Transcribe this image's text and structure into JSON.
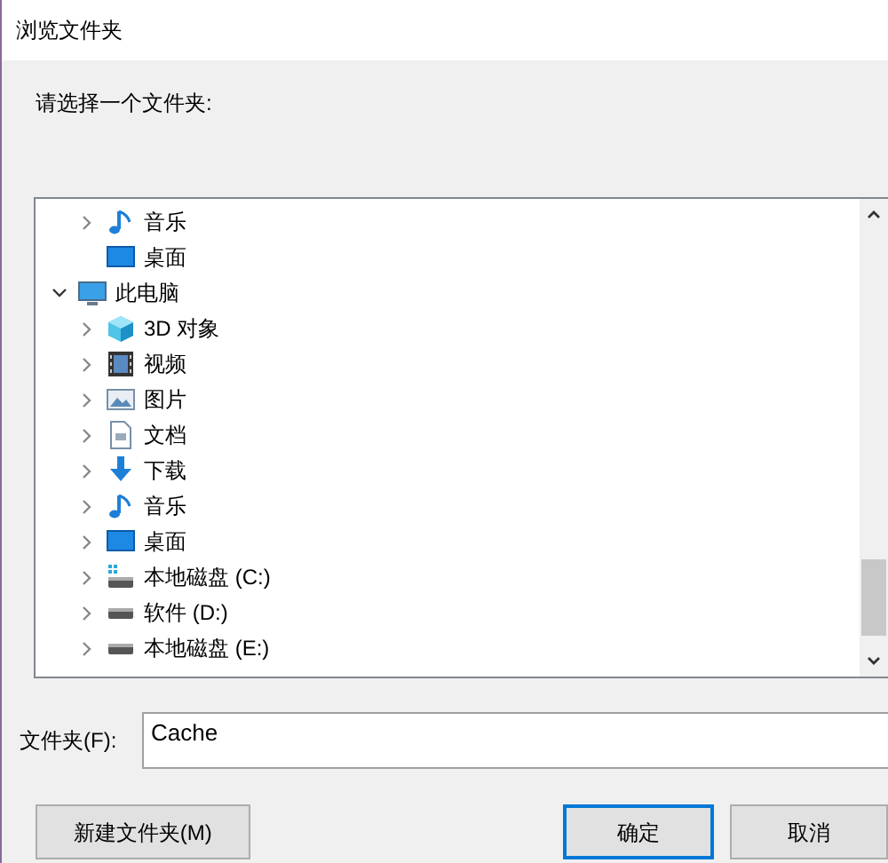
{
  "window": {
    "title": "浏览文件夹"
  },
  "prompt": "请选择一个文件夹:",
  "tree": {
    "continued_children": [
      {
        "label": "音乐",
        "kind": "music",
        "expandable": true,
        "expanded": false
      },
      {
        "label": "桌面",
        "kind": "desktop",
        "expandable": false
      }
    ],
    "items": [
      {
        "label": "此电脑",
        "kind": "computer",
        "expandable": true,
        "expanded": true,
        "children": [
          {
            "label": "3D 对象",
            "kind": "cube",
            "expandable": true,
            "expanded": false
          },
          {
            "label": "视频",
            "kind": "video",
            "expandable": true,
            "expanded": false
          },
          {
            "label": "图片",
            "kind": "pictures",
            "expandable": true,
            "expanded": false
          },
          {
            "label": "文档",
            "kind": "document",
            "expandable": true,
            "expanded": false
          },
          {
            "label": "下载",
            "kind": "download",
            "expandable": true,
            "expanded": false
          },
          {
            "label": "音乐",
            "kind": "music",
            "expandable": true,
            "expanded": false
          },
          {
            "label": "桌面",
            "kind": "desktop",
            "expandable": true,
            "expanded": false
          },
          {
            "label": "本地磁盘 (C:)",
            "kind": "system-drive",
            "expandable": true,
            "expanded": false
          },
          {
            "label": "软件 (D:)",
            "kind": "drive",
            "expandable": true,
            "expanded": false
          },
          {
            "label": "本地磁盘 (E:)",
            "kind": "drive",
            "expandable": true,
            "expanded": false
          }
        ]
      }
    ]
  },
  "folder_field": {
    "label": "文件夹(F):",
    "value": "Cache"
  },
  "buttons": [
    {
      "label": "新建文件夹(M)",
      "kind": "new-folder"
    },
    {
      "label": "确定",
      "kind": "ok",
      "default": true
    },
    {
      "label": "取消",
      "kind": "cancel",
      "default": false
    }
  ]
}
